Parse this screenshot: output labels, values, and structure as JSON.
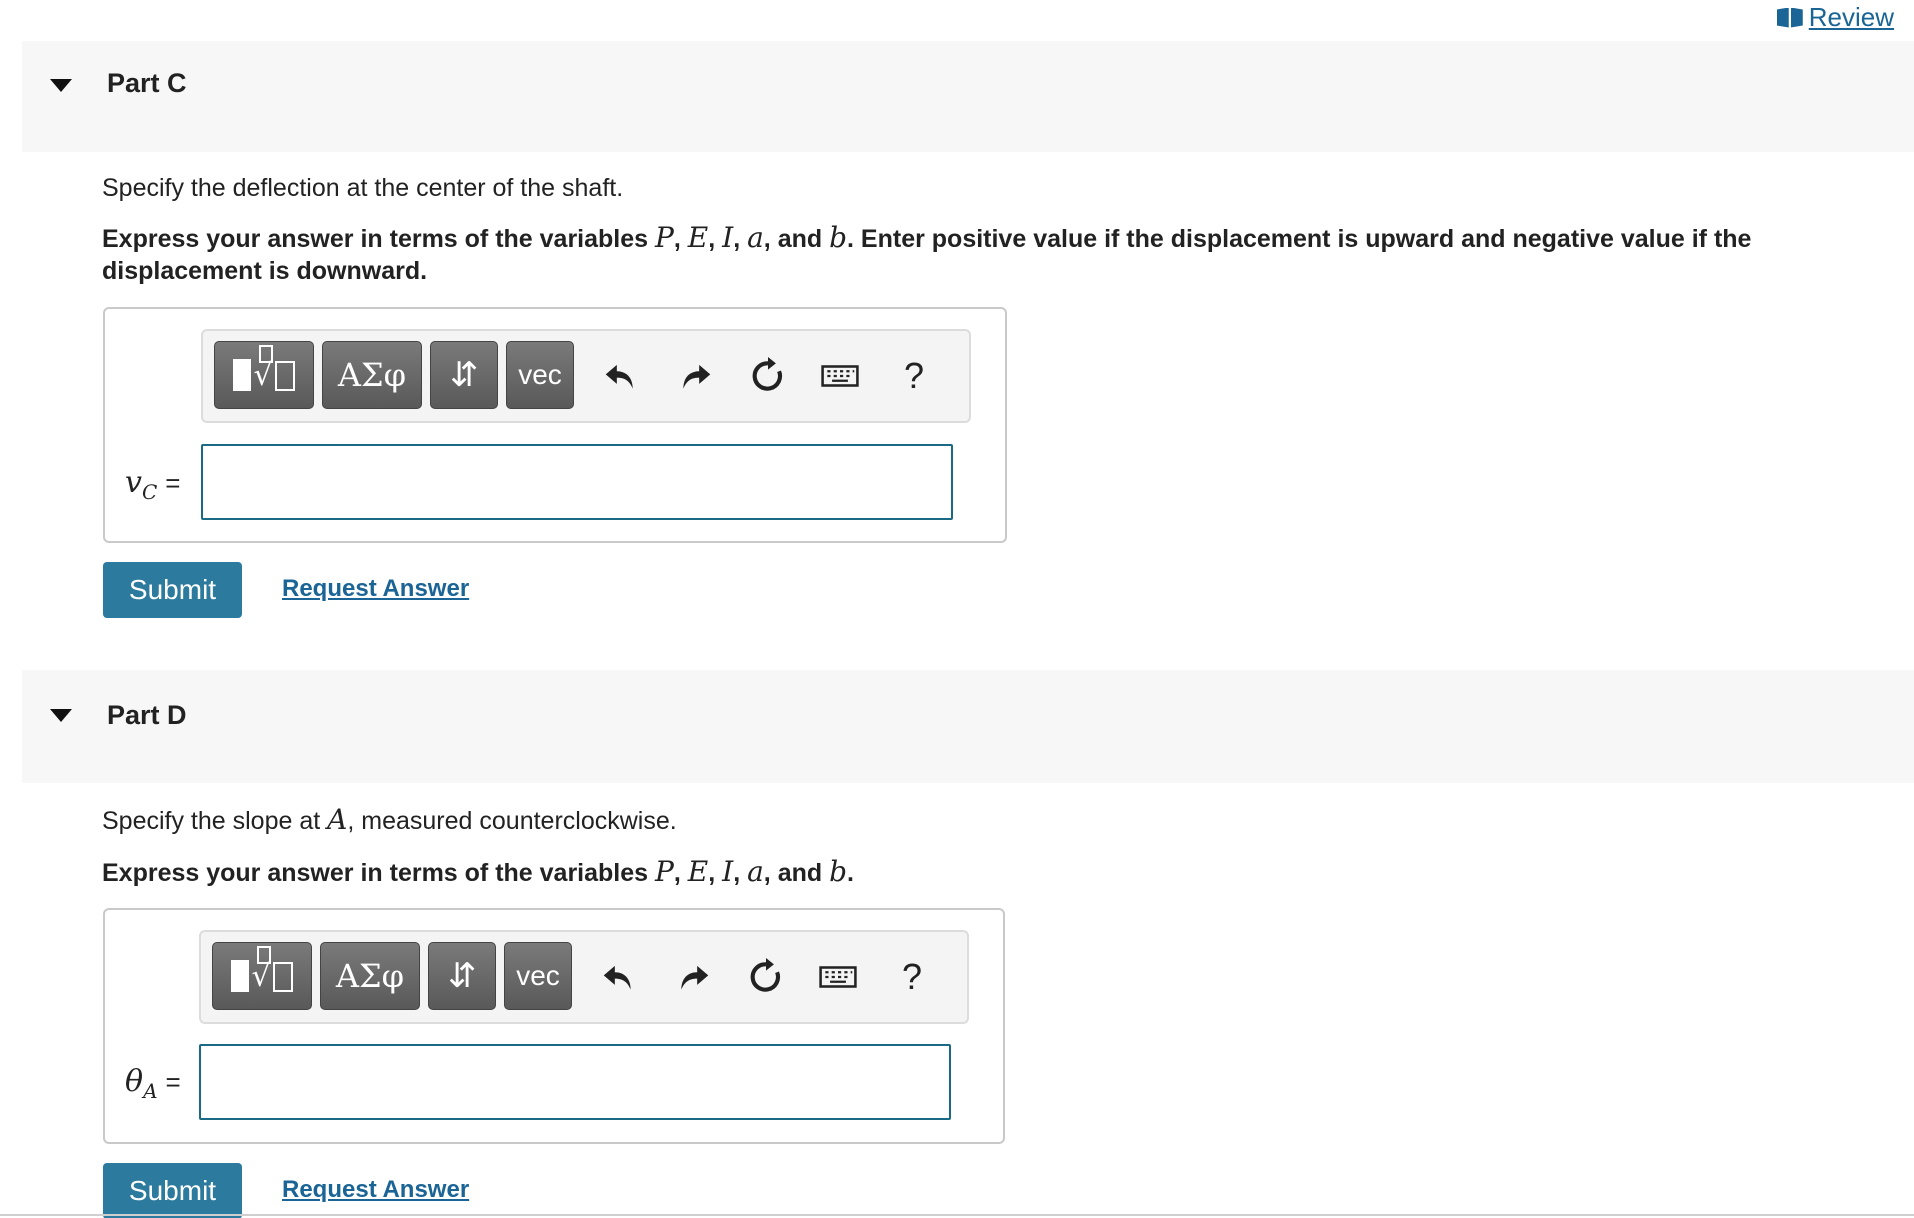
{
  "header": {
    "review_label": " Review",
    "review_icon": "book-icon"
  },
  "parts": [
    {
      "title": "Part C",
      "prompt": "Specify the deflection at the center of the shaft.",
      "instruction_prefix": "Express your answer in terms of the variables ",
      "variables": [
        "P",
        "E",
        "I",
        "a",
        "b"
      ],
      "instruction_suffix": ". Enter positive value if the displacement is upward and negative value if the displacement is downward.",
      "toolbar": {
        "templates_label": "√",
        "greek_label": "ΑΣφ",
        "arrows_label": "⇵",
        "vec_label": "vec",
        "help_label": "?"
      },
      "answer_variable": "v",
      "answer_subscript": "C",
      "equals": "=",
      "answer_value": "",
      "submit_label": "Submit",
      "request_label": "Request Answer"
    },
    {
      "title": "Part D",
      "prompt_prefix": "Specify the slope at ",
      "prompt_var": "A",
      "prompt_suffix": ", measured counterclockwise.",
      "instruction_prefix": "Express your answer in terms of the variables ",
      "variables": [
        "P",
        "E",
        "I",
        "a",
        "b"
      ],
      "instruction_suffix": ".",
      "toolbar": {
        "templates_label": "√",
        "greek_label": "ΑΣφ",
        "arrows_label": "⇵",
        "vec_label": "vec",
        "help_label": "?"
      },
      "answer_variable": "θ",
      "answer_subscript": "A",
      "equals": "=",
      "answer_value": "",
      "submit_label": "Submit",
      "request_label": "Request Answer"
    }
  ],
  "colors": {
    "accent": "#2c7a9e",
    "link": "#1a6496",
    "header_bg": "#f7f7f7",
    "input_border": "#1a6a86"
  }
}
